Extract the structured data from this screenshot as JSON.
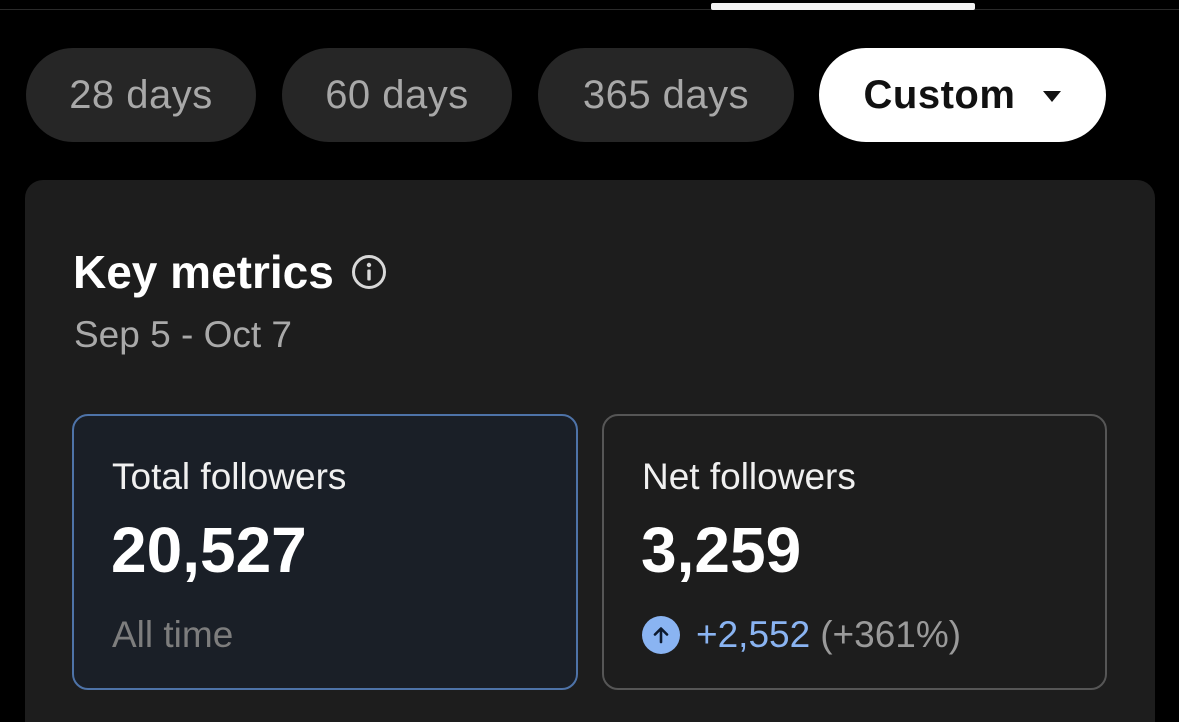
{
  "range_tabs": {
    "items": [
      {
        "label": "28 days"
      },
      {
        "label": "60 days"
      },
      {
        "label": "365 days"
      },
      {
        "label": "Custom"
      }
    ],
    "selected": "Custom"
  },
  "key_metrics": {
    "title": "Key metrics",
    "date_range": "Sep 5 - Oct 7",
    "total_followers": {
      "label": "Total followers",
      "value": "20,527",
      "sub": "All time"
    },
    "net_followers": {
      "label": "Net followers",
      "value": "3,259",
      "change_abs": "+2,552",
      "change_pct": "(+361%)"
    }
  },
  "icons": {
    "info": "info-icon",
    "up": "arrow-up-circle-icon",
    "dropdown": "caret-down-icon"
  },
  "colors": {
    "background": "#000000",
    "card": "#1d1d1d",
    "selected_pill": "#ffffff",
    "accent_blue": "#8ab4f2",
    "selected_border": "#4e73a8"
  }
}
